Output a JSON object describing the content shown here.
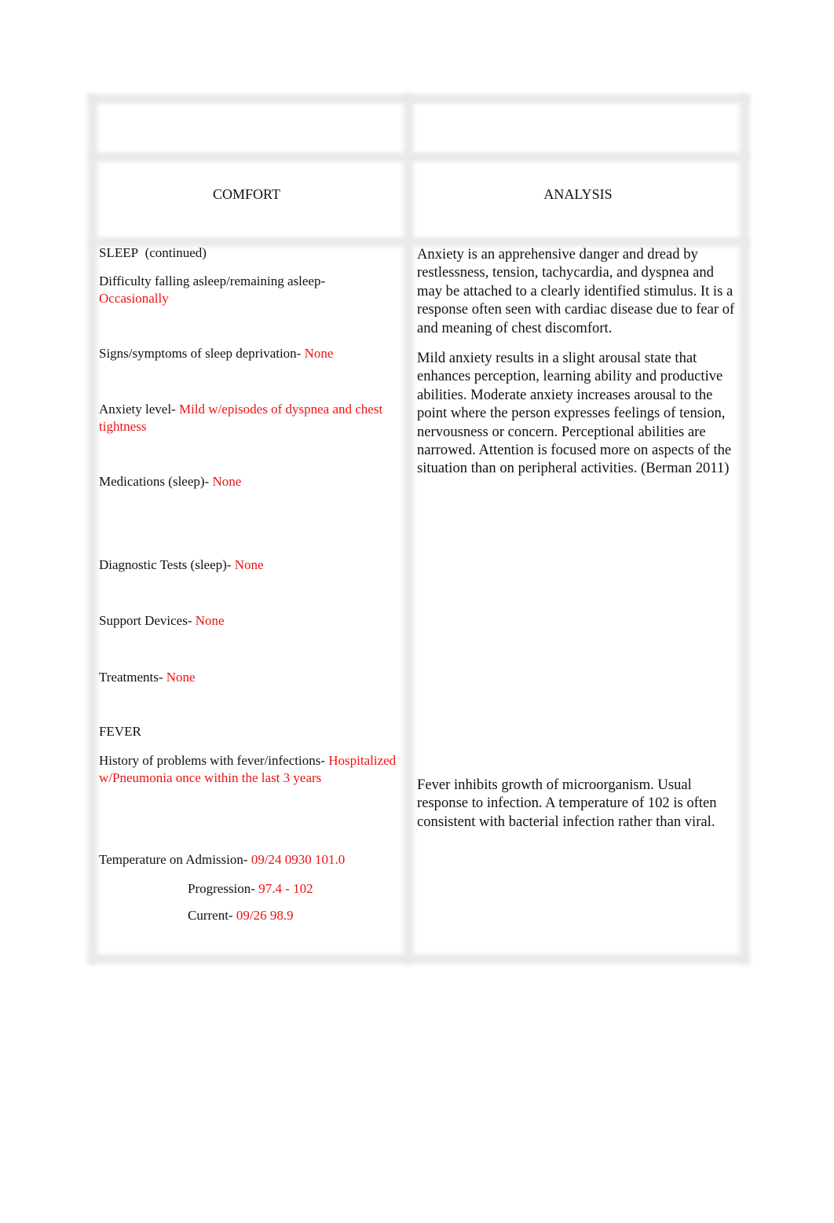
{
  "table": {
    "headers": {
      "left": "COMFORT",
      "right": "ANALYSIS"
    }
  },
  "comfort": {
    "sleep_section": {
      "title": "SLEEP",
      "title_suffix": "(continued)",
      "items": [
        {
          "label": "Difficulty falling asleep/remaining asleep-",
          "value": "Occasionally"
        },
        {
          "label": "Signs/symptoms of sleep deprivation-",
          "value": "None"
        },
        {
          "label": "Anxiety level-",
          "value": "Mild w/episodes of dyspnea and chest tightness"
        },
        {
          "label": "Medications (sleep)-",
          "value": "None"
        },
        {
          "label": "Diagnostic Tests (sleep)-",
          "value": "None"
        },
        {
          "label": "Support Devices-",
          "value": "None"
        },
        {
          "label": "Treatments-",
          "value": "None"
        }
      ]
    },
    "fever_section": {
      "title": "FEVER",
      "items": [
        {
          "label": "History of problems with fever/infections-",
          "value": "Hospitalized w/Pneumonia once within the last 3 years"
        },
        {
          "label": "Temperature on Admission-",
          "value": "09/24 0930 101.0"
        },
        {
          "label": "Progression-",
          "value": "97.4 - 102"
        },
        {
          "label": "Current-",
          "value": "09/26 98.9"
        }
      ]
    }
  },
  "analysis": {
    "paragraphs": [
      "Anxiety is an apprehensive danger and dread by restlessness, tension, tachycardia, and dyspnea and may be attached to a clearly identified stimulus. It is a response often seen with cardiac disease due to fear of and meaning of chest discomfort.",
      "Mild anxiety results in a slight arousal state that enhances perception, learning ability and productive abilities. Moderate anxiety increases arousal to the point where the person expresses feelings of tension, nervousness or concern. Perceptional abilities are narrowed. Attention is focused more on aspects of the situation than on peripheral activities. (Berman 2011)",
      "Fever inhibits growth of microorganism. Usual response to infection. A temperature of 102 is often consistent with bacterial infection rather than viral."
    ]
  },
  "colors": {
    "value_text": "#ee1111",
    "body_text": "#111111",
    "grid": "#e9e9e9"
  }
}
